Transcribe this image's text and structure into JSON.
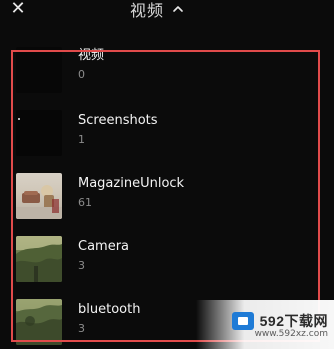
{
  "header": {
    "close_icon": "close-icon",
    "title": "视频",
    "chevron_icon": "chevron-up-icon"
  },
  "albums": [
    {
      "name": "视频",
      "count": "0",
      "thumb": "empty"
    },
    {
      "name": "Screenshots",
      "count": "1",
      "thumb": "screens"
    },
    {
      "name": "MagazineUnlock",
      "count": "61",
      "thumb": "magazine"
    },
    {
      "name": "Camera",
      "count": "3",
      "thumb": "camera"
    },
    {
      "name": "bluetooth",
      "count": "3",
      "thumb": "bluetooth"
    }
  ],
  "watermark": {
    "brand": "592下载网",
    "sub": "www.592xz.com"
  },
  "colors": {
    "background": "#0b0b0b",
    "highlight": "#e14b4b",
    "text_primary": "#f4f4f4",
    "text_secondary": "#8c8c8c"
  }
}
